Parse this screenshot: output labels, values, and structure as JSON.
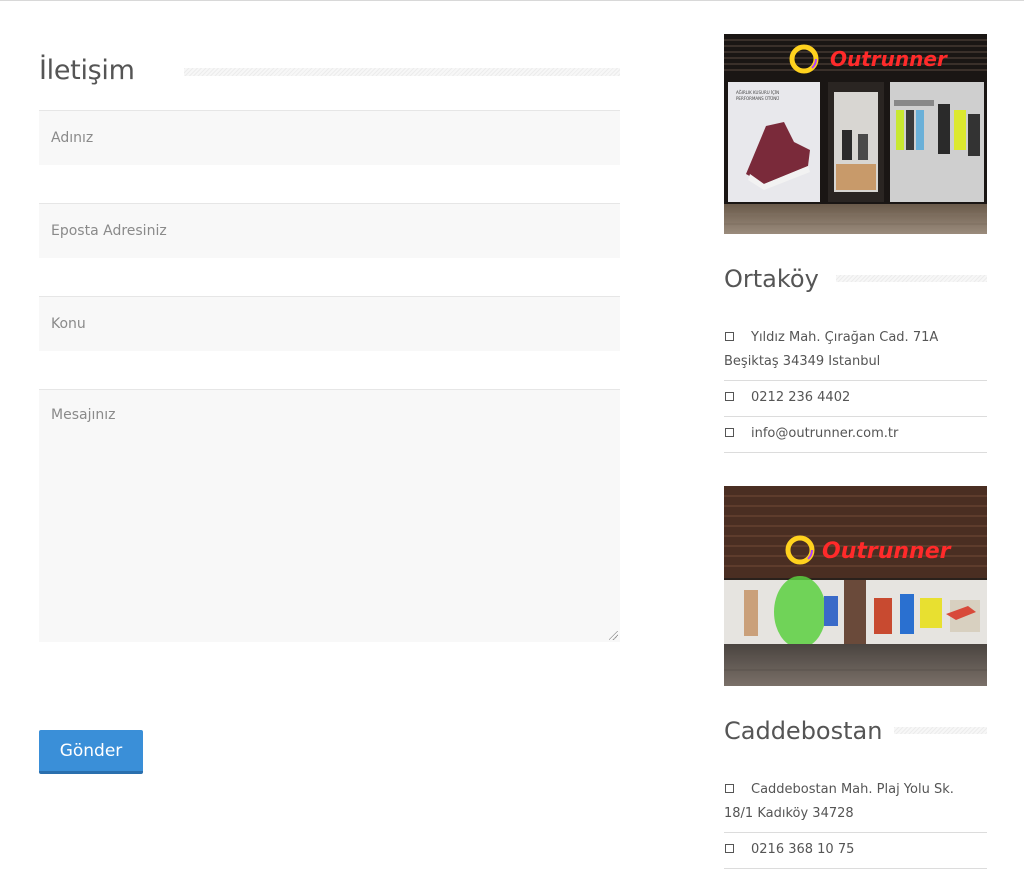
{
  "contact": {
    "title": "İletişim",
    "fields": {
      "name_placeholder": "Adınız",
      "email_placeholder": "Eposta Adresiniz",
      "subject_placeholder": "Konu",
      "message_placeholder": "Mesajınız"
    },
    "submit_label": "Gönder"
  },
  "brand": {
    "name": "Outrunner",
    "sign_color": "#ff2a2a",
    "accent_button": "#3a8fd8"
  },
  "stores": [
    {
      "name": "Ortaköy",
      "address": "Yıldız Mah. Çırağan Cad. 71A Beşiktaş 34349 Istanbul",
      "phone": "0212 236 4402",
      "email": "info@outrunner.com.tr",
      "window_text": "AĞIRLIK KUSURU İÇİN PERFORMANS ÜTÜNÜ. Spor Ayakkabı"
    },
    {
      "name": "Caddebostan",
      "address": "Caddebostan Mah. Plaj Yolu Sk. 18/1 Kadıköy 34728",
      "phone": "0216 368 10 75"
    }
  ]
}
